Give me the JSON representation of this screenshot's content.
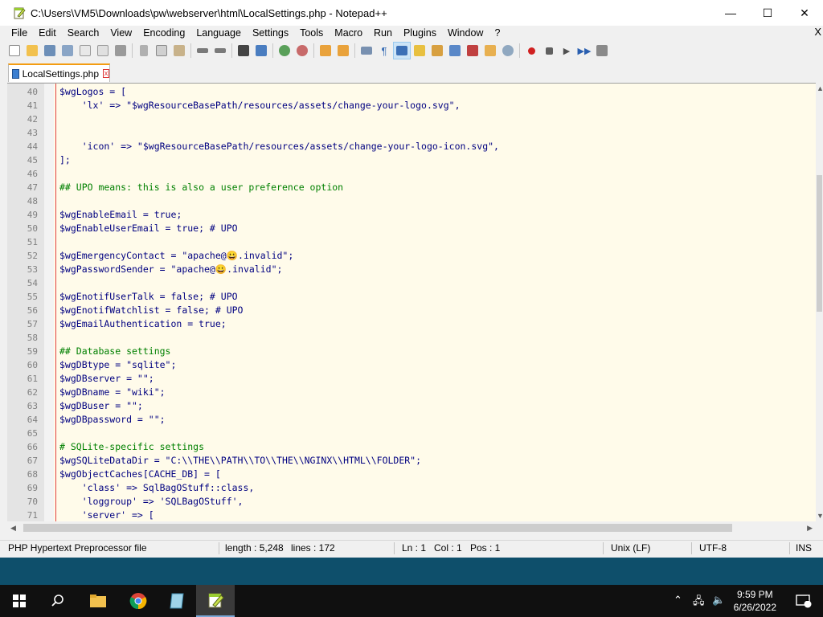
{
  "window": {
    "title": "C:\\Users\\VM5\\Downloads\\pw\\webserver\\html\\LocalSettings.php - Notepad++",
    "minimize": "—",
    "maximize": "☐",
    "close": "✕"
  },
  "menu": {
    "items": [
      "File",
      "Edit",
      "Search",
      "View",
      "Encoding",
      "Language",
      "Settings",
      "Tools",
      "Macro",
      "Run",
      "Plugins",
      "Window",
      "?"
    ],
    "close": "X"
  },
  "tab": {
    "label": "LocalSettings.php",
    "close": "x"
  },
  "editor": {
    "lines": [
      {
        "n": "40",
        "t": "$wgLogos = ["
      },
      {
        "n": "41",
        "t": "    'lx' => \"$wgResourceBasePath/resources/assets/change-your-logo.svg\","
      },
      {
        "n": "42",
        "t": ""
      },
      {
        "n": "43",
        "t": ""
      },
      {
        "n": "44",
        "t": "    'icon' => \"$wgResourceBasePath/resources/assets/change-your-logo-icon.svg\","
      },
      {
        "n": "45",
        "t": "];"
      },
      {
        "n": "46",
        "t": ""
      },
      {
        "n": "47",
        "t": "## UPO means: this is also a user preference option"
      },
      {
        "n": "48",
        "t": ""
      },
      {
        "n": "49",
        "t": "$wgEnableEmail = true;"
      },
      {
        "n": "50",
        "t": "$wgEnableUserEmail = true; # UPO"
      },
      {
        "n": "51",
        "t": ""
      },
      {
        "n": "52",
        "t": "$wgEmergencyContact = \"apache@😀.invalid\";"
      },
      {
        "n": "53",
        "t": "$wgPasswordSender = \"apache@😀.invalid\";"
      },
      {
        "n": "54",
        "t": ""
      },
      {
        "n": "55",
        "t": "$wgEnotifUserTalk = false; # UPO"
      },
      {
        "n": "56",
        "t": "$wgEnotifWatchlist = false; # UPO"
      },
      {
        "n": "57",
        "t": "$wgEmailAuthentication = true;"
      },
      {
        "n": "58",
        "t": ""
      },
      {
        "n": "59",
        "t": "## Database settings"
      },
      {
        "n": "60",
        "t": "$wgDBtype = \"sqlite\";"
      },
      {
        "n": "61",
        "t": "$wgDBserver = \"\";"
      },
      {
        "n": "62",
        "t": "$wgDBname = \"wiki\";"
      },
      {
        "n": "63",
        "t": "$wgDBuser = \"\";"
      },
      {
        "n": "64",
        "t": "$wgDBpassword = \"\";"
      },
      {
        "n": "65",
        "t": ""
      },
      {
        "n": "66",
        "t": "# SQLite-specific settings"
      },
      {
        "n": "67",
        "t": "$wgSQLiteDataDir = \"C:\\\\THE\\\\PATH\\\\TO\\\\THE\\\\NGINX\\\\HTML\\\\FOLDER\";"
      },
      {
        "n": "68",
        "t": "$wgObjectCaches[CACHE_DB] = ["
      },
      {
        "n": "69",
        "t": "    'class' => SqlBagOStuff::class,"
      },
      {
        "n": "70",
        "t": "    'loggroup' => 'SQLBagOStuff',"
      },
      {
        "n": "71",
        "t": "    'server' => ["
      }
    ]
  },
  "status": {
    "file_type": "PHP Hypertext Preprocessor file",
    "length": "length : 5,248",
    "lines": "lines : 172",
    "ln": "Ln : 1",
    "col": "Col : 1",
    "pos": "Pos : 1",
    "eol": "Unix (LF)",
    "encoding": "UTF-8",
    "mode": "INS"
  },
  "taskbar": {
    "time": "9:59 PM",
    "date": "6/26/2022",
    "notification_count": "1"
  },
  "colors": {
    "accent_tab": "#f39c12",
    "editor_bg": "#fffbea",
    "taskbar": "#101010"
  }
}
